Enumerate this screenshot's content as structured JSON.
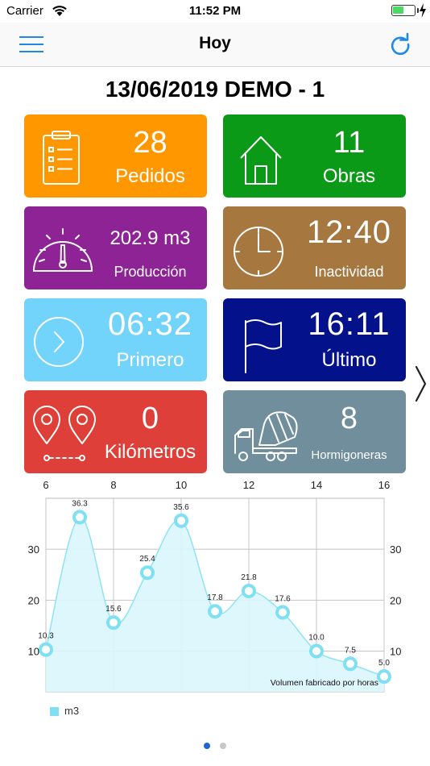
{
  "status_bar": {
    "carrier": "Carrier",
    "time": "11:52 PM",
    "battery_level": 0.5
  },
  "nav": {
    "title": "Hoy"
  },
  "page": {
    "title": "13/06/2019 DEMO - 1"
  },
  "tiles": {
    "pedidos": {
      "value": "28",
      "label": "Pedidos",
      "color": "#ff9800",
      "icon": "clipboard-icon"
    },
    "obras": {
      "value": "11",
      "label": "Obras",
      "color": "#0a9a17",
      "icon": "house-icon"
    },
    "produccion": {
      "value": "202.9 m3",
      "label": "Producción",
      "color": "#8e2396",
      "icon": "gauge-icon"
    },
    "inactividad": {
      "value": "12:40",
      "label": "Inactividad",
      "color": "#a77740",
      "icon": "clock-icon"
    },
    "primero": {
      "value": "06:32",
      "label": "Primero",
      "color": "#72d3fb",
      "icon": "chevron-right-circle-icon"
    },
    "ultimo": {
      "value": "16:11",
      "label": "Último",
      "color": "#03118a",
      "icon": "flag-icon"
    },
    "kilometros": {
      "value": "0",
      "label": "Kilómetros",
      "color": "#de4039",
      "icon": "route-pins-icon"
    },
    "hormigoneras": {
      "value": "8",
      "label": "Hormigoneras",
      "color": "#708e9c",
      "icon": "concrete-mixer-truck-icon"
    }
  },
  "chart_data": {
    "type": "area",
    "x": [
      6,
      7,
      8,
      9,
      10,
      11,
      12,
      13,
      14,
      15,
      16
    ],
    "series": [
      {
        "name": "m3",
        "values": [
          10.3,
          36.3,
          15.6,
          25.4,
          35.6,
          17.8,
          21.8,
          17.6,
          10.0,
          7.5,
          5.0
        ]
      }
    ],
    "data_labels": [
      "10.3",
      "36.3",
      "15.6",
      "25.4",
      "35.6",
      "17.8",
      "21.8",
      "17.6",
      "10.0",
      "7.5",
      "5.0"
    ],
    "x_ticks": [
      "6",
      "8",
      "10",
      "12",
      "14",
      "16"
    ],
    "y_ticks": [
      "10",
      "20",
      "30"
    ],
    "xlim": [
      6,
      16
    ],
    "ylim": [
      2,
      40
    ],
    "x_axis_position": "top",
    "y_axis_position": "both",
    "grid": true,
    "annotation": "Volumen fabricado por horas",
    "legend_position": "bottom-left",
    "line_color": "#8fe3f5",
    "fill_color": "#d9f6fd",
    "marker_color": "#7fe0f4"
  },
  "legend": {
    "label": "m3"
  },
  "pager": {
    "count": 2,
    "active": 1
  }
}
